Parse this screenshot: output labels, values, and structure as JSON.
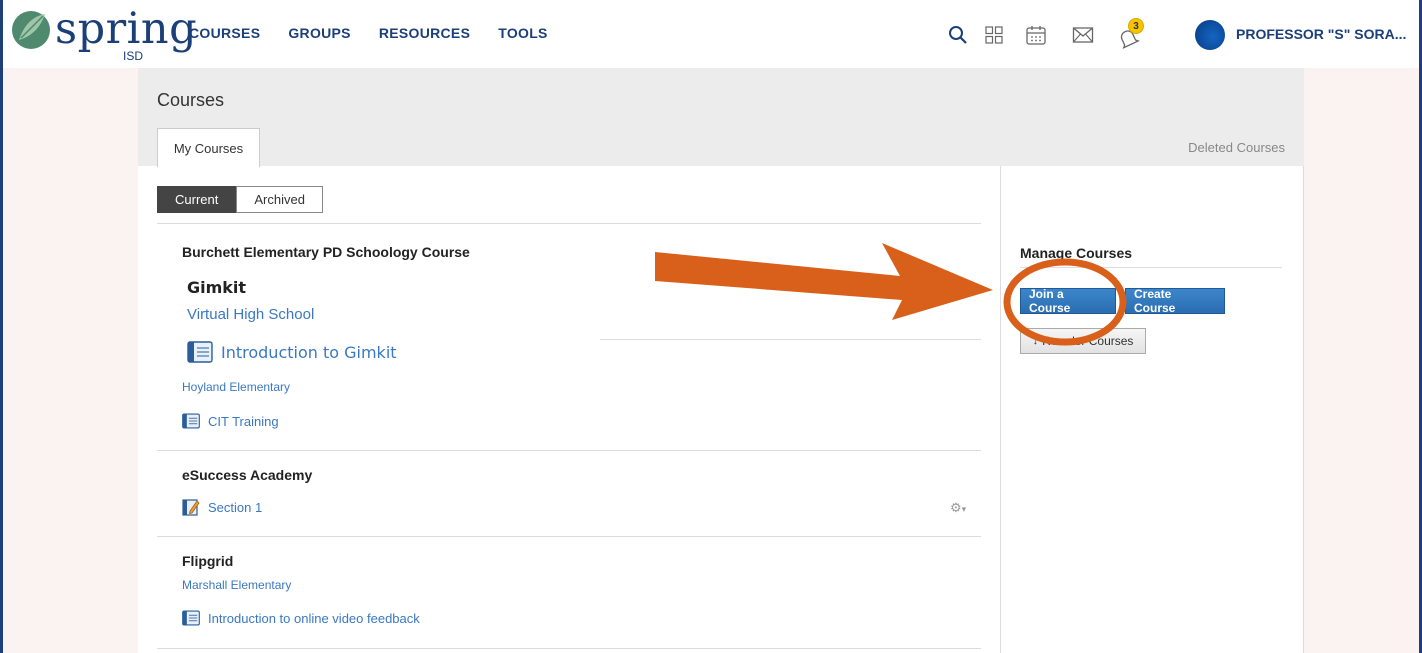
{
  "brand": {
    "logo_text": "spring",
    "logo_sub": "ISD"
  },
  "nav": {
    "items": [
      {
        "label": "COURSES"
      },
      {
        "label": "GROUPS"
      },
      {
        "label": "RESOURCES"
      },
      {
        "label": "TOOLS"
      }
    ],
    "notification_count": "3",
    "user_name": "PROFESSOR \"S\" SORA..."
  },
  "page": {
    "title": "Courses",
    "tab_label": "My Courses",
    "deleted_link": "Deleted Courses",
    "toggle": {
      "current": "Current",
      "archived": "Archived"
    }
  },
  "courses": {
    "group1": {
      "title": "Burchett Elementary PD Schoology Course",
      "sub_title": "Gimkit",
      "school": "Virtual High School",
      "course": "Introduction to Gimkit",
      "school2": "Hoyland Elementary",
      "course2": "CIT Training"
    },
    "group2": {
      "title": "eSuccess Academy",
      "course": "Section 1"
    },
    "group3": {
      "title": "Flipgrid",
      "school": "Marshall Elementary",
      "course": "Introduction to online video feedback"
    }
  },
  "manage": {
    "title": "Manage Courses",
    "join_label": "Join a Course",
    "create_label": "Create Course",
    "reorder_label": "Reorder Courses"
  },
  "colors": {
    "nav_text": "#1b3f78",
    "link": "#3a78c3",
    "button_blue": "#2a6db0",
    "annotation": "#d9601a"
  }
}
